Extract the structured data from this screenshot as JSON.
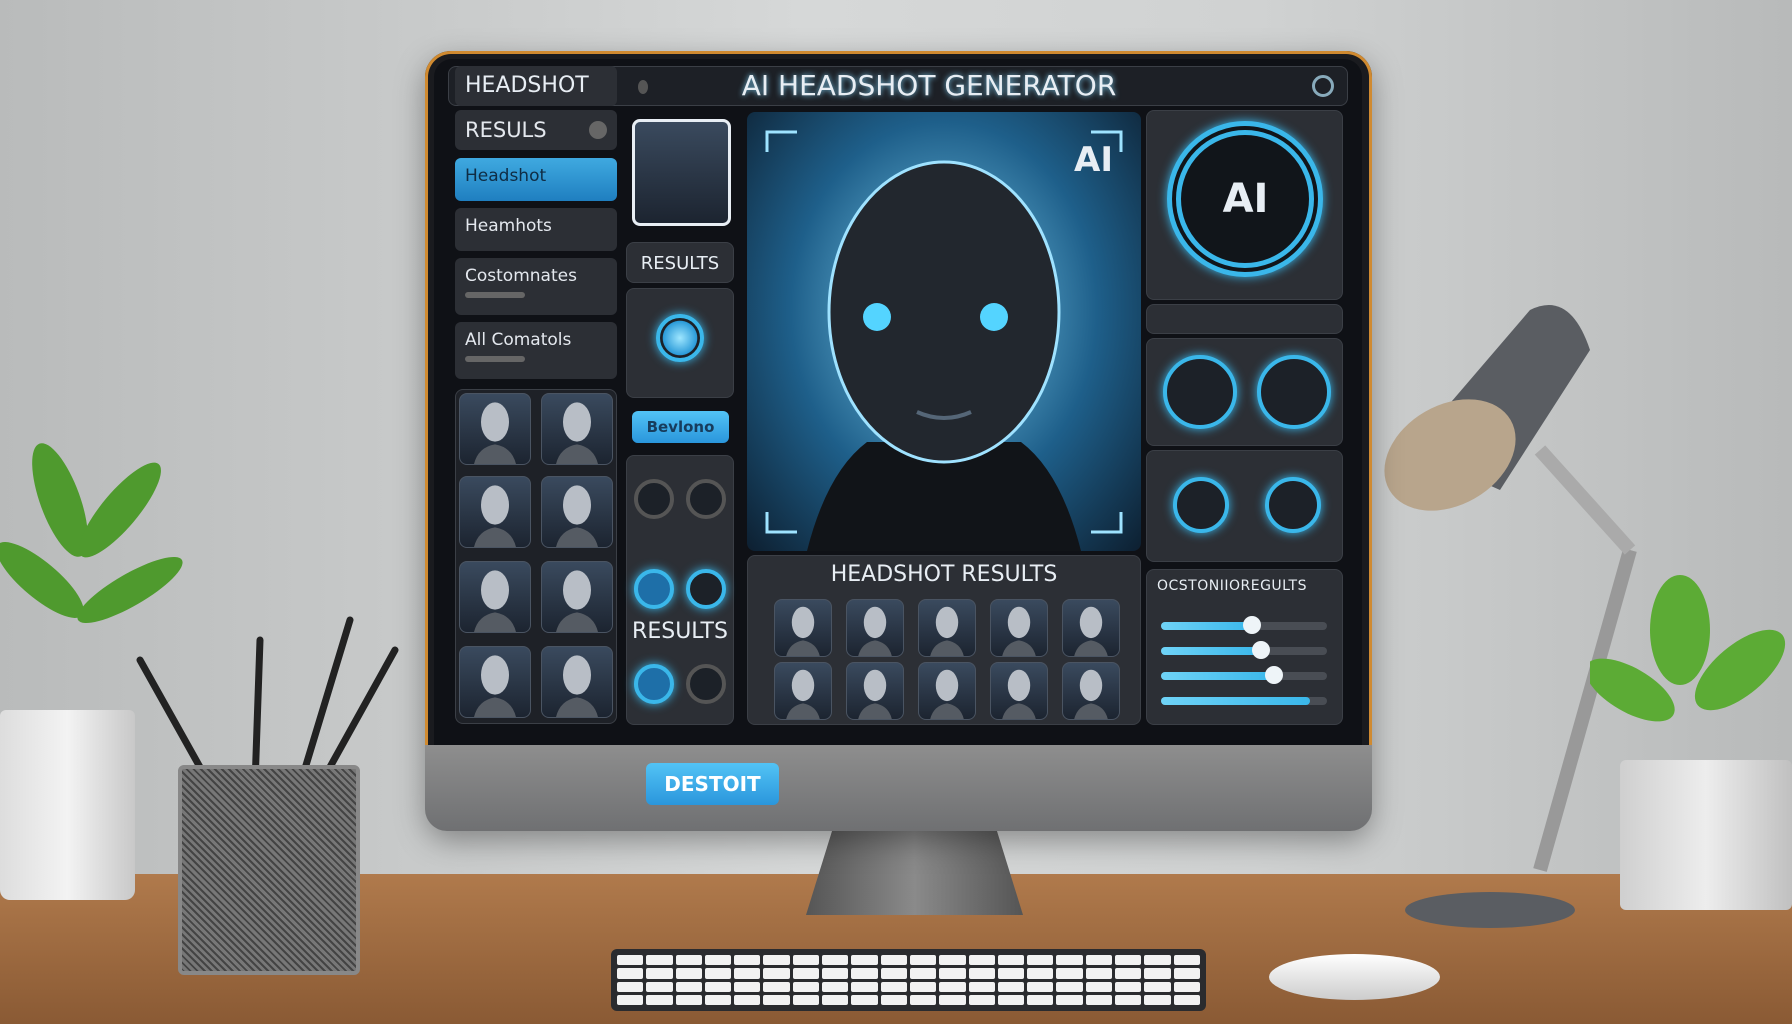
{
  "app": {
    "title": "AI HEADSHOT GENERATOR",
    "brand": "HEADSHOT",
    "accent": "#3ab7ea"
  },
  "sidebar": {
    "items": [
      {
        "label": "RESULS",
        "active": false
      },
      {
        "label": "Headshot",
        "active": true
      },
      {
        "label": "Heamhots",
        "active": false
      },
      {
        "label": "Costomnates",
        "active": false
      },
      {
        "label": "All Comatols",
        "active": false
      }
    ]
  },
  "middle": {
    "results_label": "RESULTS",
    "button_label": "Bevlono",
    "results_label_2": "RESULTS"
  },
  "preview": {
    "badge": "AI"
  },
  "right": {
    "ai_ring_label": "AI",
    "customize_title": "OCSTONIIOREGULTS",
    "sliders": [
      0.55,
      0.6,
      0.68,
      0.9
    ]
  },
  "results": {
    "title": "HEADSHOT RESULTS",
    "thumbnail_count": 10
  },
  "chin": {
    "button_label": "DESTOIT"
  }
}
